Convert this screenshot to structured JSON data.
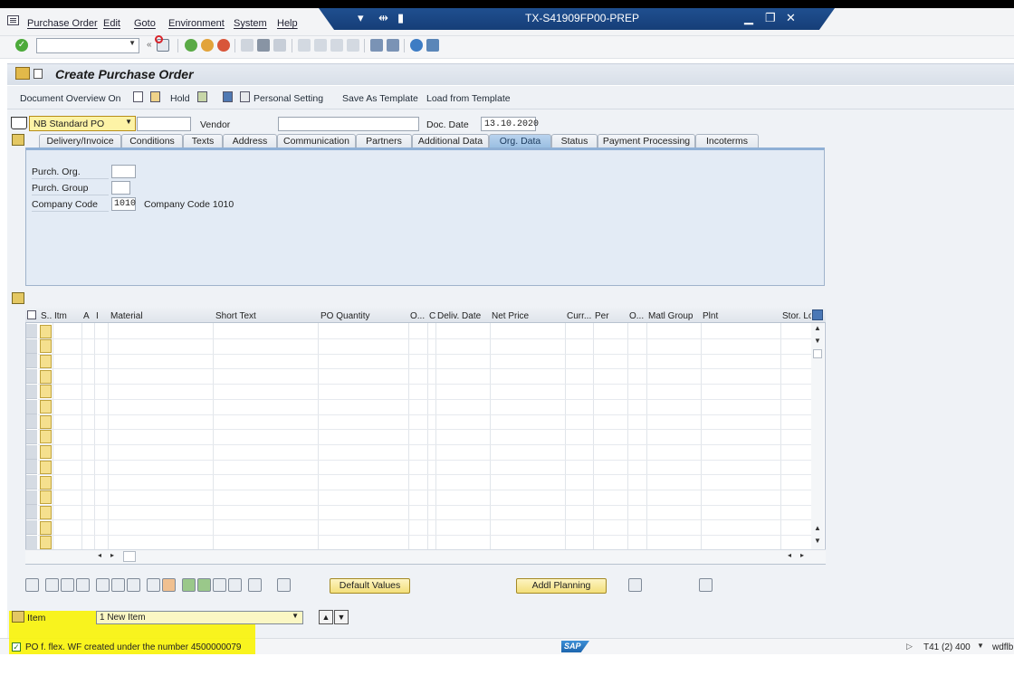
{
  "menu": {
    "items": [
      "Purchase Order",
      "Edit",
      "Goto",
      "Environment",
      "System",
      "Help"
    ]
  },
  "window": {
    "system_title": "TX-S41909FP00-PREP"
  },
  "page": {
    "title": "Create Purchase Order"
  },
  "app_toolbar": {
    "document_overview": "Document Overview On",
    "hold": "Hold",
    "personal_setting": "Personal Setting",
    "save_as_template": "Save As Template",
    "load_from_template": "Load from Template"
  },
  "header": {
    "po_type": "NB Standard PO",
    "vendor_label": "Vendor",
    "vendor_value": "",
    "doc_date_label": "Doc. Date",
    "doc_date_value": "13.10.2020"
  },
  "tabs": [
    {
      "label": "Delivery/Invoice",
      "active": false
    },
    {
      "label": "Conditions",
      "active": false
    },
    {
      "label": "Texts",
      "active": false
    },
    {
      "label": "Address",
      "active": false
    },
    {
      "label": "Communication",
      "active": false
    },
    {
      "label": "Partners",
      "active": false
    },
    {
      "label": "Additional Data",
      "active": false
    },
    {
      "label": "Org. Data",
      "active": true
    },
    {
      "label": "Status",
      "active": false
    },
    {
      "label": "Payment Processing",
      "active": false
    },
    {
      "label": "Incoterms",
      "active": false
    }
  ],
  "org_data": {
    "purch_org_label": "Purch. Org.",
    "purch_org_value": "",
    "purch_group_label": "Purch. Group",
    "purch_group_value": "",
    "company_code_label": "Company Code",
    "company_code_value": "1010",
    "company_code_desc": "Company Code 1010"
  },
  "item_grid": {
    "columns": [
      "S..",
      "Itm",
      "A",
      "I",
      "Material",
      "Short Text",
      "PO Quantity",
      "O...",
      "C",
      "Deliv. Date",
      "Net Price",
      "Curr...",
      "Per",
      "O...",
      "Matl Group",
      "Plnt",
      "Stor. Lo"
    ],
    "row_count": 15
  },
  "bottom": {
    "default_values": "Default Values",
    "addl_planning": "Addl Planning",
    "item_label": "Item",
    "item_selected": "1 New Item"
  },
  "status": {
    "message": "PO f. flex. WF created under the number 4500000079",
    "sap_logo": "SAP",
    "system_info": "T41 (2) 400",
    "user": "wdflb"
  },
  "colors": {
    "title_band": "#1f4f8f",
    "active_tab": "#9bbfe2",
    "highlight": "#f8f30b",
    "button": "#f3df7a"
  }
}
